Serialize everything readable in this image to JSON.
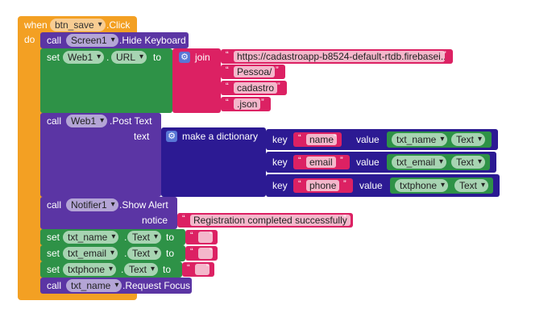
{
  "event": {
    "when": "when",
    "component": "btn_save",
    "event_name": ".Click",
    "do": "do"
  },
  "hide_keyboard": {
    "call": "call",
    "component": "Screen1",
    "method": ".Hide Keyboard"
  },
  "set_url": {
    "set": "set",
    "component": "Web1",
    "dot": ".",
    "property": "URL",
    "to": "to",
    "join": "join",
    "parts": [
      "https://cadastroapp-b8524-default-rtdb.firebasei...",
      "Pessoa/",
      "cadastro",
      ".json"
    ]
  },
  "post_text": {
    "call": "call",
    "component": "Web1",
    "method": ".Post Text",
    "arg_label": "text",
    "make_dict": "make a dictionary",
    "pairs": [
      {
        "key_label": "key",
        "key": "name",
        "value_label": "value",
        "component": "txt_name",
        "property": "Text"
      },
      {
        "key_label": "key",
        "key": "email",
        "value_label": "value",
        "component": "txt_email",
        "property": "Text"
      },
      {
        "key_label": "key",
        "key": "phone",
        "value_label": "value",
        "component": "txtphone",
        "property": "Text"
      }
    ]
  },
  "show_alert": {
    "call": "call",
    "component": "Notifier1",
    "method": ".Show Alert",
    "arg_label": "notice",
    "message": "Registration completed successfully"
  },
  "clear_sets": [
    {
      "set": "set",
      "component": "txt_name",
      "property": "Text",
      "to": "to",
      "dot": "."
    },
    {
      "set": "set",
      "component": "txt_email",
      "property": "Text",
      "to": "to",
      "dot": "."
    },
    {
      "set": "set",
      "component": "txtphone",
      "property": "Text",
      "to": "to",
      "dot": "."
    }
  ],
  "request_focus": {
    "call": "call",
    "component": "txt_name",
    "method": ".Request Focus"
  },
  "quote": "“",
  "quote_close": "”",
  "colors": {
    "event": "#f3a023",
    "call": "#5b35a4",
    "set": "#2e9247",
    "text": "#dc2163",
    "dictionary": "#2c1a93"
  }
}
